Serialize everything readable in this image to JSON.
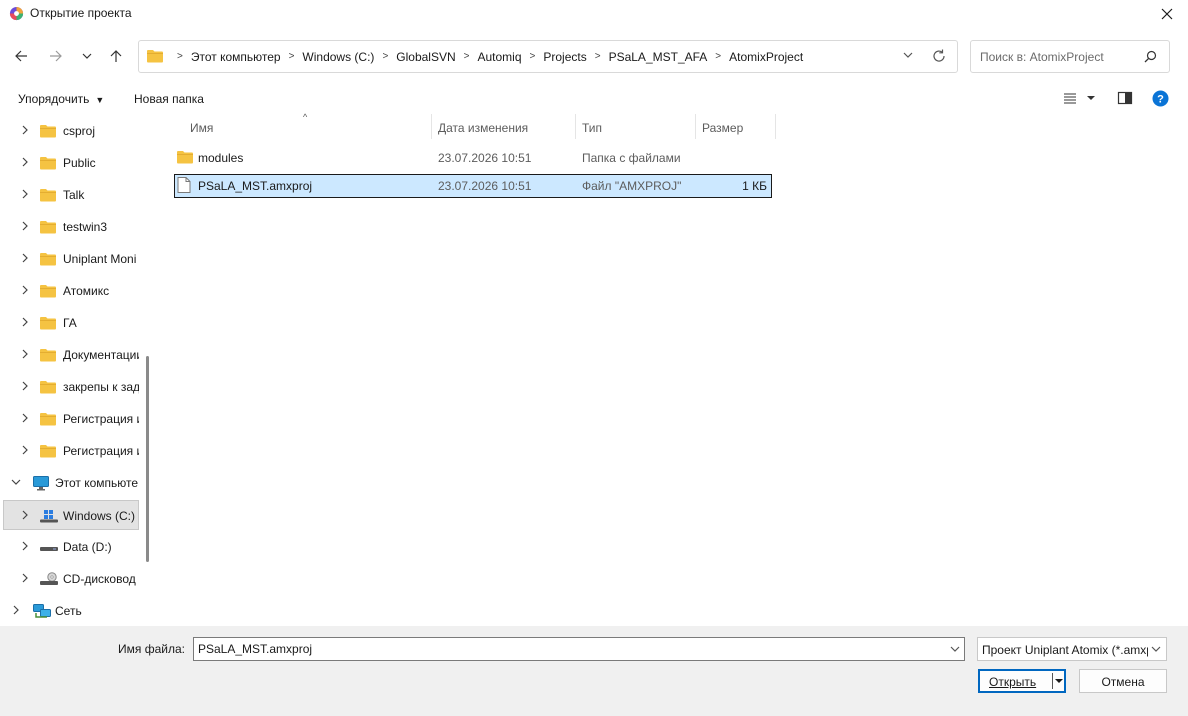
{
  "window": {
    "title": "Открытие проекта"
  },
  "nav": {
    "breadcrumbs": [
      "Этот компьютер",
      "Windows (C:)",
      "GlobalSVN",
      "Automiq",
      "Projects",
      "PSaLA_MST_AFA",
      "AtomixProject"
    ],
    "search_placeholder": "Поиск в: AtomixProject"
  },
  "cmdbar": {
    "organize": "Упорядочить",
    "new_folder": "Новая папка"
  },
  "tree": [
    {
      "label": "csproj",
      "icon": "folder-icon",
      "expandable": true,
      "level": 1
    },
    {
      "label": "Public",
      "icon": "folder-icon",
      "expandable": true,
      "level": 1
    },
    {
      "label": "Talk",
      "icon": "folder-icon",
      "expandable": true,
      "level": 1
    },
    {
      "label": "testwin3",
      "icon": "folder-icon",
      "expandable": true,
      "level": 1
    },
    {
      "label": "Uniplant Moni",
      "icon": "folder-icon",
      "expandable": true,
      "level": 1
    },
    {
      "label": "Атомикс",
      "icon": "folder-icon",
      "expandable": true,
      "level": 1
    },
    {
      "label": "ГА",
      "icon": "folder-icon",
      "expandable": true,
      "level": 1
    },
    {
      "label": "Документации",
      "icon": "folder-icon",
      "expandable": true,
      "level": 1
    },
    {
      "label": "закрепы к зад",
      "icon": "folder-icon",
      "expandable": true,
      "level": 1
    },
    {
      "label": "Регистрация и",
      "icon": "folder-icon",
      "expandable": true,
      "level": 1
    },
    {
      "label": "Регистрация и",
      "icon": "folder-icon",
      "expandable": true,
      "level": 1
    },
    {
      "label": "Этот компьюте",
      "icon": "computer-icon",
      "expandable": true,
      "expanded": true,
      "level": 0
    },
    {
      "label": "Windows (C:)",
      "icon": "windows-drive-icon",
      "expandable": true,
      "level": 1,
      "selected": true
    },
    {
      "label": "Data (D:)",
      "icon": "drive-icon",
      "expandable": true,
      "level": 1
    },
    {
      "label": "CD-дисковод",
      "icon": "cd-drive-icon",
      "expandable": true,
      "level": 1
    },
    {
      "label": "Сеть",
      "icon": "network-icon",
      "expandable": true,
      "level": 0
    }
  ],
  "columns": {
    "name": "Имя",
    "date": "Дата изменения",
    "type": "Тип",
    "size": "Размер"
  },
  "files": [
    {
      "name": "modules",
      "date": "23.07.2026 10:51",
      "type": "Папка с файлами",
      "size": "",
      "icon": "folder-icon",
      "selected": false
    },
    {
      "name": "PSaLA_MST.amxproj",
      "date": "23.07.2026 10:51",
      "type": "Файл \"AMXPROJ\"",
      "size": "1 КБ",
      "icon": "file-icon",
      "selected": true
    }
  ],
  "bottom": {
    "filename_label": "Имя файла:",
    "filename_value": "PSaLA_MST.amxproj",
    "filetype_value": "Проект Uniplant Atomix (*.amxproj)",
    "open_label": "Открыть",
    "cancel_label": "Отмена"
  },
  "colors": {
    "accent": "#0067c0",
    "selection": "#cce8ff",
    "folder": "#f5c342",
    "help": "#0a74d6"
  }
}
